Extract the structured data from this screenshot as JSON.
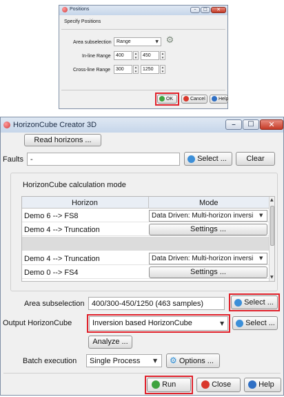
{
  "positions_dialog": {
    "title": "Positions",
    "subtitle": "Specify Positions",
    "area_subselection_label": "Area subselection",
    "area_subselection_value": "Range",
    "inline_range_label": "In-line Range",
    "inline_from": "400",
    "inline_to": "450",
    "crossline_range_label": "Cross-line Range",
    "crossline_from": "300",
    "crossline_to": "1250",
    "ok_label": "OK",
    "cancel_label": "Cancel",
    "help_label": "Help"
  },
  "horizoncube_dialog": {
    "title": "HorizonCube Creator 3D",
    "read_horizons_label": "Read horizons ...",
    "faults_label": "Faults",
    "faults_value": "-",
    "select_label": "Select ...",
    "clear_label": "Clear",
    "calc_mode_label": "HorizonCube calculation mode",
    "table": {
      "headers": [
        "Horizon",
        "Mode"
      ],
      "rows": [
        {
          "horizon": "Demo 6 --> FS8",
          "mode": "Data Driven: Multi-horizon inversi",
          "kind": "dropdown"
        },
        {
          "horizon": "Demo 4 --> Truncation",
          "mode": "Settings ...",
          "kind": "button"
        },
        {
          "horizon": "Demo 4 --> Truncation",
          "mode": "Data Driven: Multi-horizon inversi",
          "kind": "dropdown"
        },
        {
          "horizon": "Demo 0 --> FS4",
          "mode": "Settings ...",
          "kind": "button"
        }
      ]
    },
    "area_subselection_label": "Area subselection",
    "area_subselection_value": "400/300-450/1250 (463 samples)",
    "area_select_label": "Select ...",
    "output_label": "Output HorizonCube",
    "output_value": "Inversion based HorizonCube",
    "output_select_label": "Select ...",
    "analyze_label": "Analyze ...",
    "batch_label": "Batch execution",
    "batch_value": "Single Process",
    "options_label": "Options ...",
    "run_label": "Run",
    "close_label": "Close",
    "help_label": "Help"
  },
  "colors": {
    "highlight": "#e0202a",
    "ok_green": "#3fa33f",
    "cancel_red": "#d9372b",
    "help_blue": "#2f6fc4"
  },
  "icons": [
    "minimize-icon",
    "maximize-icon",
    "close-icon",
    "app-icon",
    "select-icon",
    "clear-icon",
    "settings-icon"
  ]
}
